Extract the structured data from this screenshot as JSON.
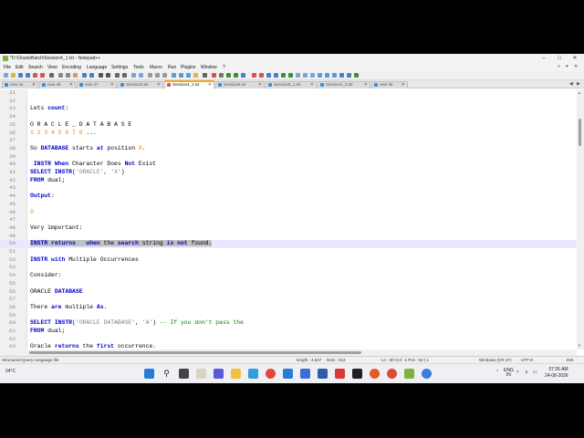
{
  "window": {
    "title": "*D:\\OracleBatch\\Session4_1.txt - Notepad++"
  },
  "menu": [
    "File",
    "Edit",
    "Search",
    "View",
    "Encoding",
    "Language",
    "Settings",
    "Tools",
    "Macro",
    "Run",
    "Plugins",
    "Window",
    "?"
  ],
  "menu_right": [
    "+",
    "▾",
    "✕"
  ],
  "tabs": [
    {
      "label": "new 44",
      "active": false
    },
    {
      "label": "new 49",
      "active": false
    },
    {
      "label": "new 47",
      "active": false
    },
    {
      "label": "Session3.txt",
      "active": false
    },
    {
      "label": "Session4_1.txt",
      "active": true
    },
    {
      "label": "Session5.txt",
      "active": false
    },
    {
      "label": "Session5_1.txt",
      "active": false
    },
    {
      "label": "Session4_2.txt",
      "active": false
    },
    {
      "label": "new 45",
      "active": false
    }
  ],
  "editor": {
    "lines": [
      {
        "n": "31",
        "html": ""
      },
      {
        "n": "32",
        "html": ""
      },
      {
        "n": "33",
        "html": "Lets <span class='kw'>count</span>:"
      },
      {
        "n": "34",
        "html": ""
      },
      {
        "n": "35",
        "html": "O R A C L E _ D A T A B A S E"
      },
      {
        "n": "36",
        "html": "<span class='num'>1 2 3 4 5 6 7 8</span> ..."
      },
      {
        "n": "37",
        "html": ""
      },
      {
        "n": "38",
        "html": "So <span class='kw'>DATABASE</span> starts <span class='kw'>at</span> position <span class='num'>8</span>."
      },
      {
        "n": "39",
        "html": ""
      },
      {
        "n": "40",
        "html": " <span class='kw'>INSTR When</span> Character Does <span class='kw'>Not</span> Exist"
      },
      {
        "n": "41",
        "html": "<span class='kw'>SELECT INSTR</span>(<span class='str'>'ORACLE'</span>, <span class='str'>'X'</span>)"
      },
      {
        "n": "42",
        "html": "<span class='kw'>FROM</span> dual;"
      },
      {
        "n": "43",
        "html": ""
      },
      {
        "n": "44",
        "html": "<span class='kw'>Output</span>:"
      },
      {
        "n": "45",
        "html": ""
      },
      {
        "n": "46",
        "html": "<span class='num'>0</span>"
      },
      {
        "n": "47",
        "html": ""
      },
      {
        "n": "48",
        "html": "Very important:"
      },
      {
        "n": "49",
        "html": ""
      },
      {
        "n": "50",
        "html": "<span class='sel'><span class='kw'>INSTR returns</span>   <span class='kw'>when</span> the <span class='kw'>search</span> string <span class='kw'>is not</span> found.</span>",
        "hl": true
      },
      {
        "n": "51",
        "html": ""
      },
      {
        "n": "52",
        "html": "<span class='kw'>INSTR with</span> Multiple Occurrences"
      },
      {
        "n": "53",
        "html": ""
      },
      {
        "n": "54",
        "html": "Consider:"
      },
      {
        "n": "55",
        "html": ""
      },
      {
        "n": "56",
        "html": "ORACLE <span class='kw'>DATABASE</span>"
      },
      {
        "n": "57",
        "html": ""
      },
      {
        "n": "58",
        "html": "There <span class='kw'>are</span> multiple <span class='kw'>As</span>."
      },
      {
        "n": "59",
        "html": ""
      },
      {
        "n": "60",
        "html": "<span class='kw'>SELECT INSTR</span>(<span class='str'>'ORACLE DATABASE'</span>, <span class='str'>'A'</span>) <span class='cmt'>-- If you don't pass the</span>"
      },
      {
        "n": "61",
        "html": "<span class='kw'>FROM</span> dual;"
      },
      {
        "n": "62",
        "html": ""
      },
      {
        "n": "63",
        "html": "Oracle <span class='kw'>returns</span> the <span class='kw'>first</span> occurrence."
      }
    ]
  },
  "statusbar": {
    "language": "Structured Query Language file",
    "length": "length : 4,647",
    "lines": "lines : 312",
    "position": "Ln : 50    Col : 1    Pos : 52 | 1",
    "eol": "Windows (CR LF)",
    "encoding": "UTF-8",
    "mode": "INS"
  },
  "taskbar": {
    "weather": "24°C",
    "lang_top": "ENG",
    "lang_bottom": "IN",
    "time": "07:26 AM",
    "date": "24-08-2026"
  },
  "colors": {
    "keyword": "#0000c8",
    "number": "#ff8000",
    "string": "#808080",
    "comment": "#008000",
    "current_line": "#e8e8ff",
    "active_tab_accent": "#f5a623"
  }
}
